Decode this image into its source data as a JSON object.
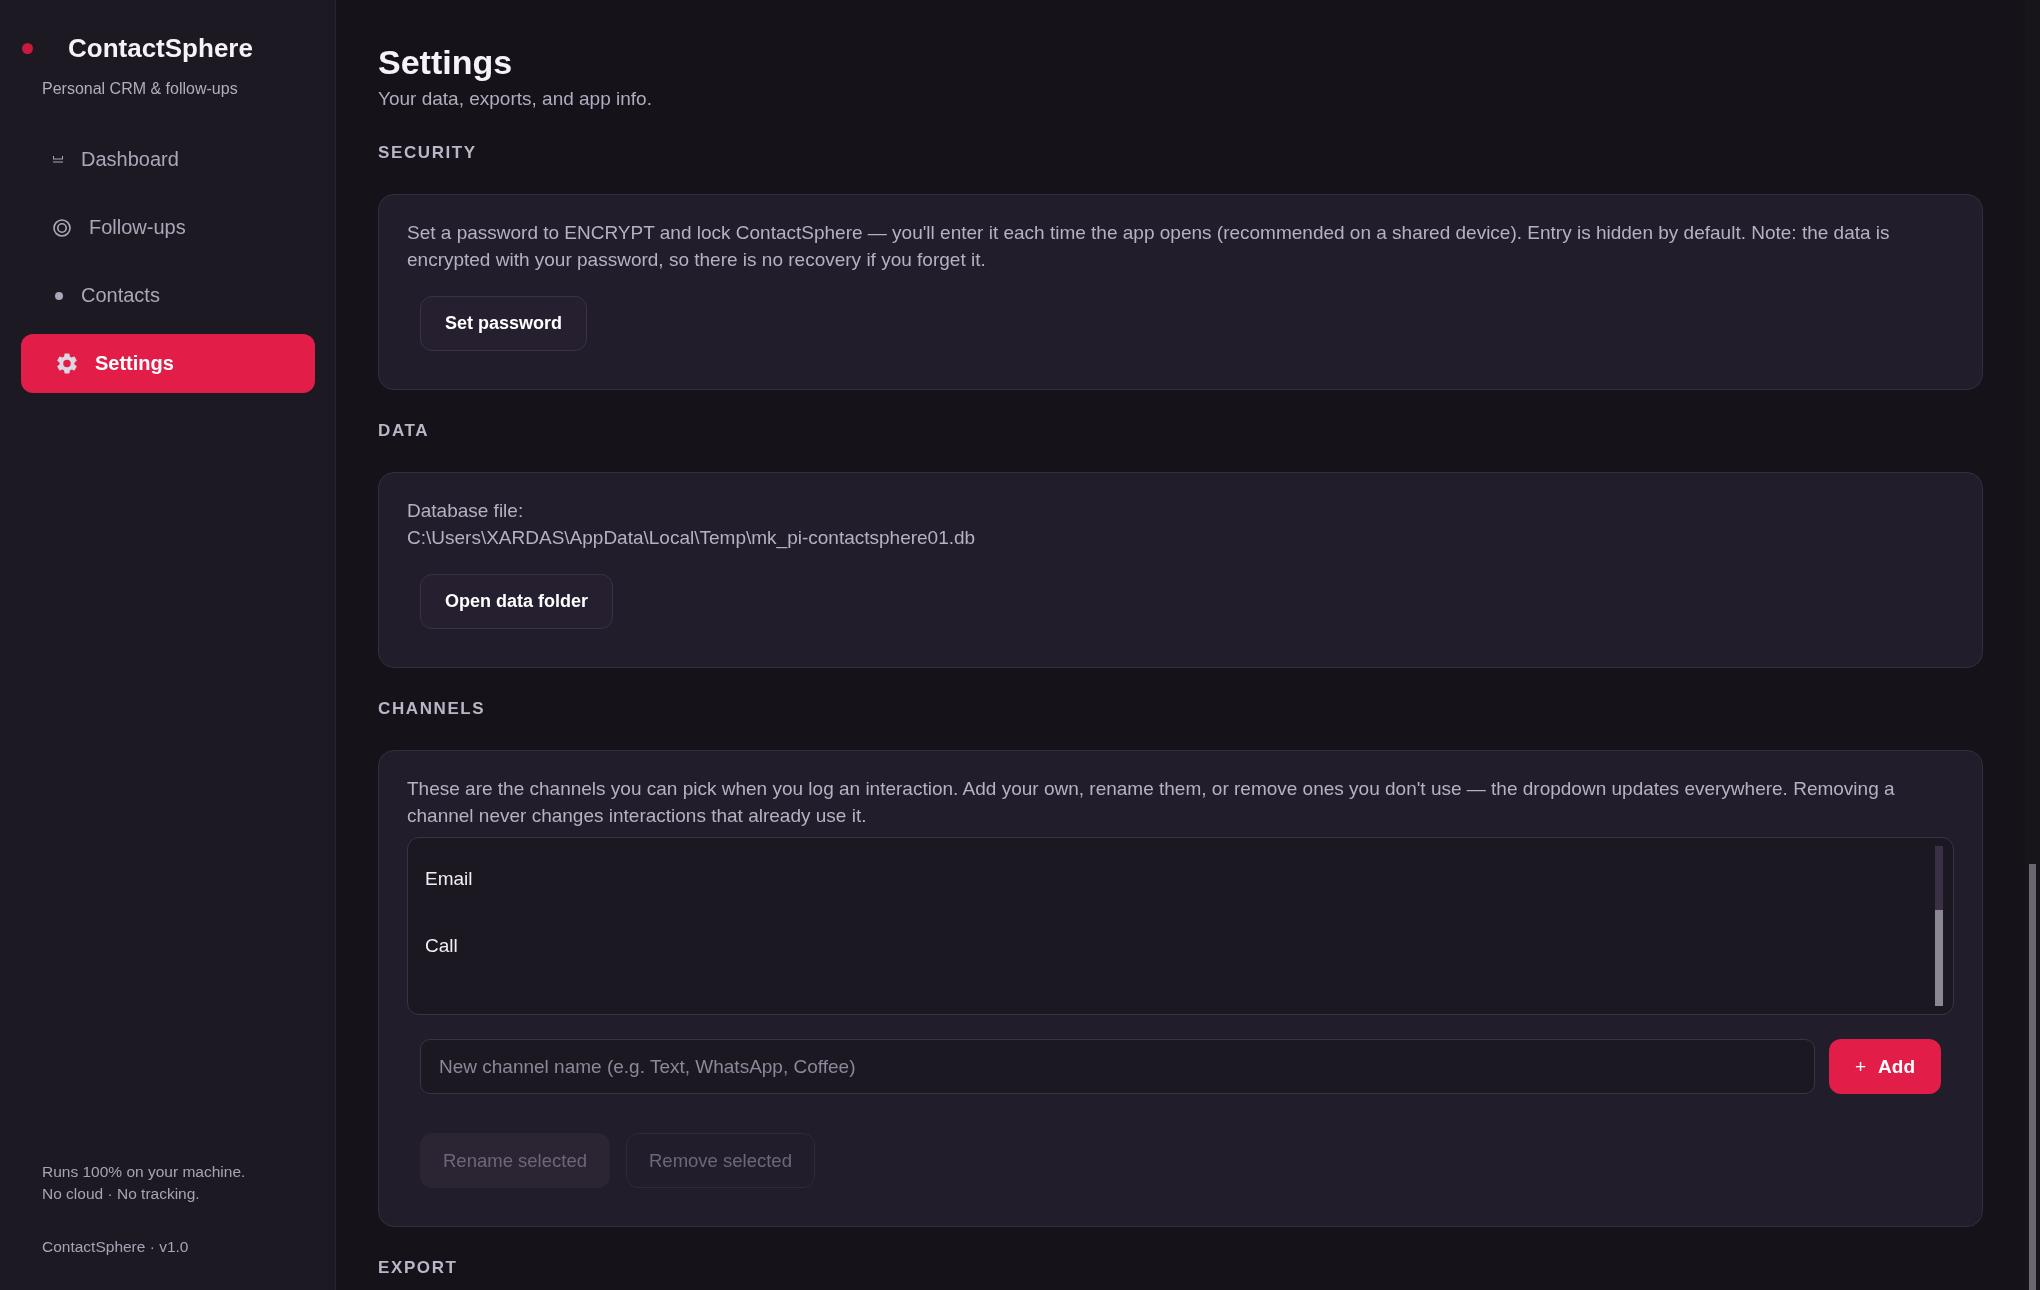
{
  "sidebar": {
    "app_name": "ContactSphere",
    "tagline": "Personal CRM & follow-ups",
    "nav": [
      {
        "label": "Dashboard",
        "selected": false
      },
      {
        "label": "Follow-ups",
        "selected": false
      },
      {
        "label": "Contacts",
        "selected": false
      },
      {
        "label": "Settings",
        "selected": true
      }
    ],
    "footer_notes": [
      "Runs 100% on your machine.",
      "No cloud · No tracking."
    ],
    "version": "ContactSphere · v1.0"
  },
  "page": {
    "title": "Settings",
    "subtitle": "Your data, exports, and app info."
  },
  "security": {
    "heading": "SECURITY",
    "description": "Set a password to ENCRYPT and lock ContactSphere — you'll enter it each time the app opens (recommended on a shared device). Entry is hidden by default. Note: the data is encrypted with your password, so there is no recovery if you forget it.",
    "button": "Set password"
  },
  "data": {
    "heading": "DATA",
    "file_label": "Database file:",
    "file_path": "C:\\Users\\XARDAS\\AppData\\Local\\Temp\\mk_pi-contactsphere01.db",
    "button": "Open data folder"
  },
  "channels": {
    "heading": "CHANNELS",
    "description": "These are the channels you can pick when you log an interaction. Add your own, rename them, or remove ones you don't use — the dropdown updates everywhere. Removing a channel never changes interactions that already use it.",
    "items": [
      {
        "label": "Email",
        "selected": false
      },
      {
        "label": "Call",
        "selected": false
      }
    ],
    "new_channel": {
      "placeholder": "New channel name (e.g. Text, WhatsApp, Coffee)"
    },
    "add_button": {
      "symbol": "+",
      "label": "Add"
    },
    "actions": [
      {
        "label": "Rename selected",
        "kind": "soft",
        "disabled": true
      },
      {
        "label": "Remove selected",
        "kind": "outline",
        "disabled": true
      }
    ]
  },
  "export": {
    "heading": "EXPORT"
  }
}
